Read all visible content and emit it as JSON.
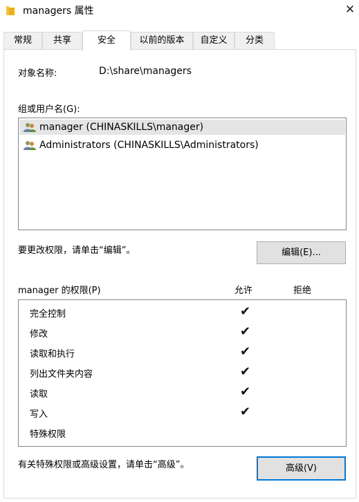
{
  "window": {
    "title": "managers 属性",
    "close_glyph": "✕"
  },
  "tabs": [
    {
      "label": "常规"
    },
    {
      "label": "共享"
    },
    {
      "label": "安全",
      "active": true
    },
    {
      "label": "以前的版本"
    },
    {
      "label": "自定义"
    },
    {
      "label": "分类"
    }
  ],
  "security": {
    "object_name_label": "对象名称:",
    "object_name_value": "D:\\share\\managers",
    "groups_label": "组或用户名(G):",
    "groups": [
      {
        "name": "manager (CHINASKILLS\\manager)",
        "selected": true,
        "icon": "users-icon"
      },
      {
        "name": "Administrators (CHINASKILLS\\Administrators)",
        "selected": false,
        "icon": "users-icon"
      }
    ],
    "edit_hint": "要更改权限，请单击“编辑”。",
    "edit_button": "编辑(E)...",
    "permissions_label": "manager 的权限(P)",
    "allow_header": "允许",
    "deny_header": "拒绝",
    "permissions": [
      {
        "name": "完全控制",
        "allow": "✔",
        "deny": ""
      },
      {
        "name": "修改",
        "allow": "✔",
        "deny": ""
      },
      {
        "name": "读取和执行",
        "allow": "✔",
        "deny": ""
      },
      {
        "name": "列出文件夹内容",
        "allow": "✔",
        "deny": ""
      },
      {
        "name": "读取",
        "allow": "✔",
        "deny": ""
      },
      {
        "name": "写入",
        "allow": "✔",
        "deny": ""
      },
      {
        "name": "特殊权限",
        "allow": "",
        "deny": ""
      }
    ],
    "advanced_hint": "有关特殊权限或高级设置，请单击“高级”。",
    "advanced_button": "高级(V)"
  },
  "colors": {
    "folder": "#f4c430",
    "accent": "#0078d7",
    "selection": "#e5e5e5"
  }
}
